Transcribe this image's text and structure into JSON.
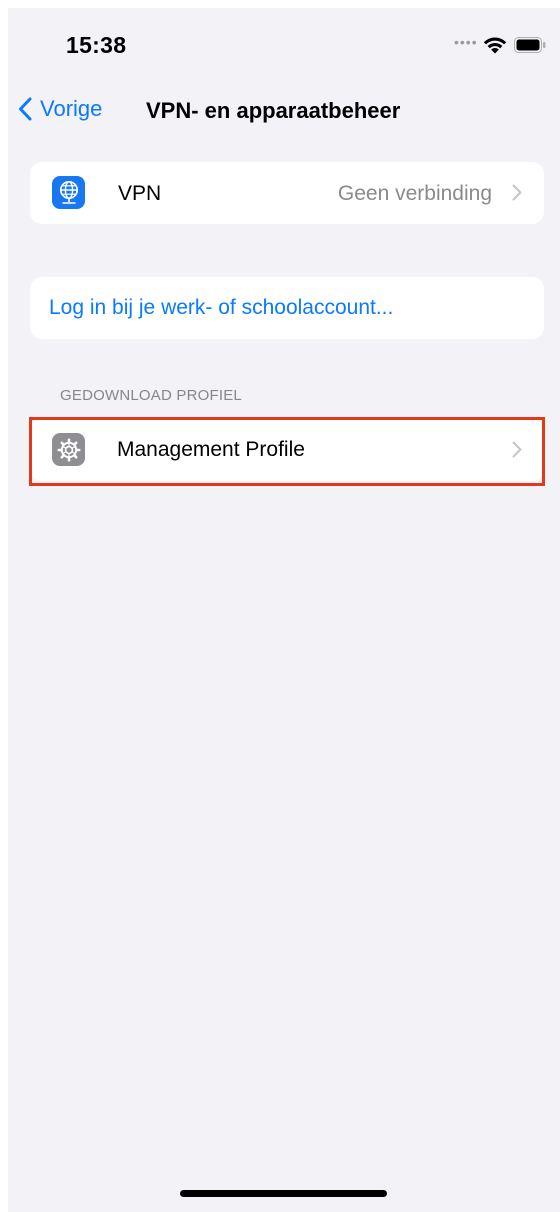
{
  "status_bar": {
    "time": "15:38",
    "signal_icon": "signal-dots-icon",
    "wifi_icon": "wifi-icon",
    "battery_icon": "battery-icon"
  },
  "nav": {
    "back_label": "Vorige",
    "title": "VPN- en apparaatbeheer"
  },
  "vpn_row": {
    "icon": "vpn-globe-icon",
    "label": "VPN",
    "value": "Geen verbinding"
  },
  "login_row": {
    "label": "Log in bij je werk- of schoolaccount..."
  },
  "profile_section": {
    "header": "GEDOWNLOAD PROFIEL",
    "items": [
      {
        "icon": "gear-icon",
        "label": "Management Profile",
        "highlighted": true
      }
    ]
  },
  "colors": {
    "accent": "#0a7aff",
    "highlight": "#e0391c",
    "vpn_icon_bg": "#1778f2",
    "settings_icon_bg": "#8e8e93",
    "background": "#f2f2f7"
  }
}
